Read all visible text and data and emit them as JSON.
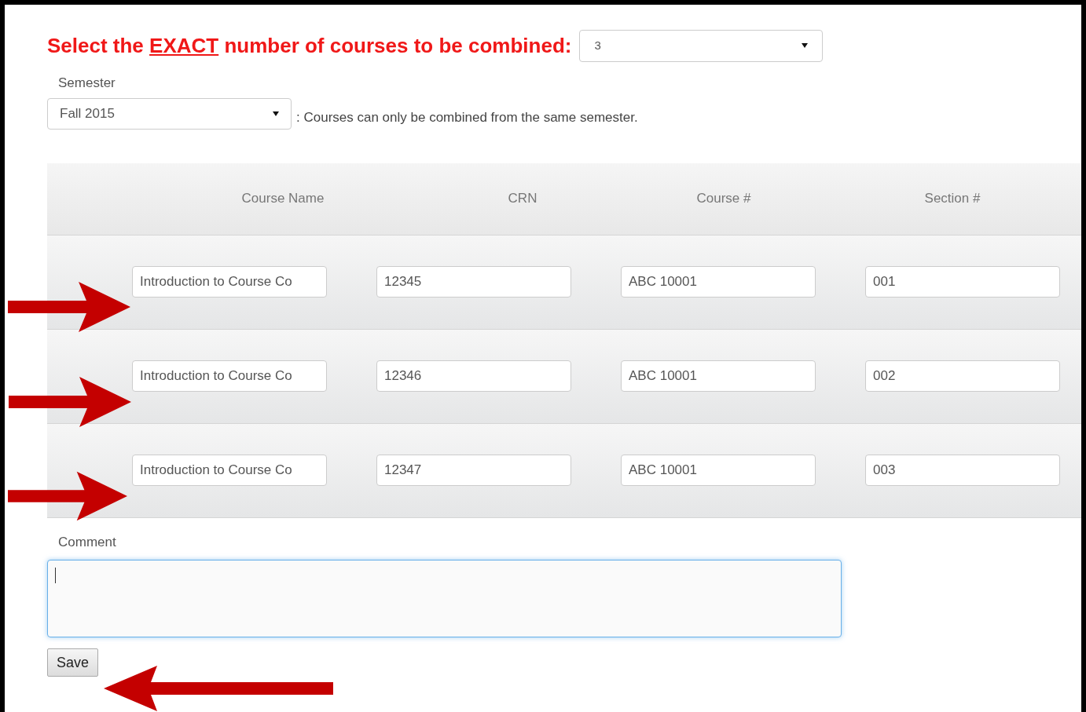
{
  "heading": {
    "before": "Select the ",
    "emphasis": "EXACT",
    "after": " number of courses to be combined:"
  },
  "count_select": {
    "value": "3"
  },
  "semester": {
    "label": "Semester",
    "value": "Fall 2015",
    "note": ": Courses can only be combined from the same semester."
  },
  "table": {
    "columns": [
      "Course Name",
      "CRN",
      "Course #",
      "Section #"
    ],
    "rows": [
      {
        "cells": [
          "Introduction to Course Co",
          "12345",
          "ABC 10001",
          "001"
        ]
      },
      {
        "cells": [
          "Introduction to Course Co",
          "12346",
          "ABC 10001",
          "002"
        ]
      },
      {
        "cells": [
          "Introduction to Course Co",
          "12347",
          "ABC 10001",
          "003"
        ]
      }
    ]
  },
  "comment": {
    "label": "Comment",
    "focused": true
  },
  "buttons": [
    "Save"
  ]
}
